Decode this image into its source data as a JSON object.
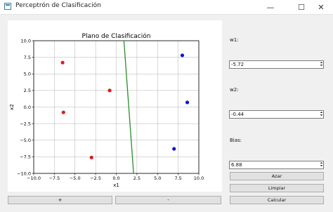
{
  "window": {
    "title": "Perceptrón de Clasificación",
    "minimize_glyph": "—",
    "maximize_glyph": "☐",
    "close_glyph": "✕"
  },
  "chart_data": {
    "type": "scatter",
    "title": "Plano de Clasificación",
    "xlabel": "x1",
    "ylabel": "x2",
    "xlim": [
      -10,
      10
    ],
    "ylim": [
      -10,
      10
    ],
    "xticks": [
      -10,
      -7.5,
      -5,
      -2.5,
      0,
      2.5,
      5,
      7.5,
      10
    ],
    "yticks": [
      -10,
      -7.5,
      -5,
      -2.5,
      0,
      2.5,
      5,
      7.5,
      10
    ],
    "xtick_labels": [
      "−10.0",
      "−7.5",
      "−5.0",
      "−2.5",
      "0.0",
      "2.5",
      "5.0",
      "7.5",
      "10.0"
    ],
    "ytick_labels": [
      "−10.0",
      "−7.5",
      "−5.0",
      "−2.5",
      "0.0",
      "2.5",
      "5.0",
      "7.5",
      "10.0"
    ],
    "grid": true,
    "series": [
      {
        "color": "#dd1c1c",
        "points": [
          [
            -6.5,
            6.7
          ],
          [
            -6.4,
            -0.8
          ],
          [
            -0.8,
            2.5
          ],
          [
            -3.0,
            -7.6
          ]
        ]
      },
      {
        "color": "#1515cc",
        "points": [
          [
            8.0,
            7.8
          ],
          [
            8.6,
            0.7
          ],
          [
            7.0,
            -6.3
          ]
        ]
      }
    ],
    "decision_line": {
      "color": "#2a8c2a",
      "points": [
        [
          0.93,
          10
        ],
        [
          2.1,
          -10
        ]
      ]
    }
  },
  "inputs": {
    "w1_label": "w1:",
    "w1_value": "-5.72",
    "w2_label": "w2:",
    "w2_value": "-0.44",
    "bias_label": "Bias:",
    "bias_value": "6.88"
  },
  "buttons": {
    "random": "Azar",
    "clear": "Limpiar",
    "compute": "Calcular",
    "plus": "+",
    "minus": "-"
  }
}
